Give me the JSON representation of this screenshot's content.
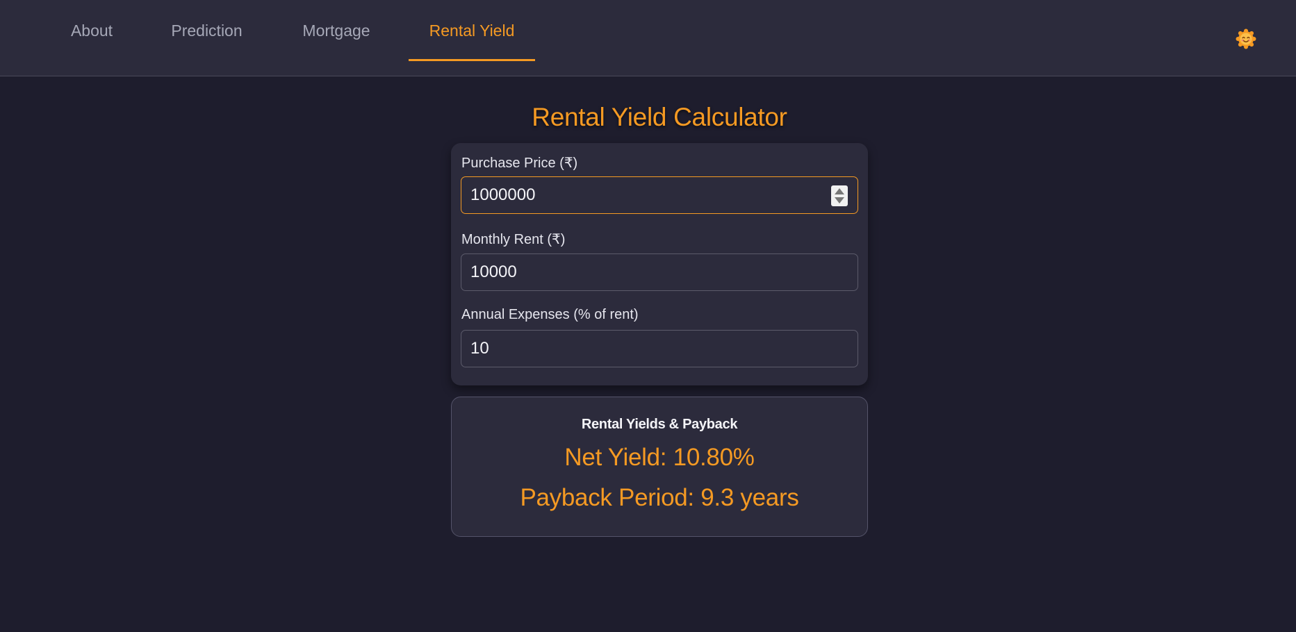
{
  "nav": {
    "tabs": [
      {
        "label": "About"
      },
      {
        "label": "Prediction"
      },
      {
        "label": "Mortgage"
      },
      {
        "label": "Rental Yield",
        "active": true
      }
    ],
    "theme_toggle_icon": "sun-face-icon"
  },
  "page": {
    "title": "Rental Yield Calculator"
  },
  "form": {
    "purchase_price": {
      "label": "Purchase Price (₹)",
      "value": "1000000"
    },
    "monthly_rent": {
      "label": "Monthly Rent (₹)",
      "value": "10000"
    },
    "annual_expenses": {
      "label": "Annual Expenses (% of rent)",
      "value": "10"
    }
  },
  "results": {
    "heading": "Rental Yields & Payback",
    "net_yield": "Net Yield: 10.80%",
    "payback_period": "Payback Period: 9.3 years"
  },
  "colors": {
    "accent": "#f59a23",
    "background": "#1e1d2d",
    "card": "#2c2b3c"
  }
}
